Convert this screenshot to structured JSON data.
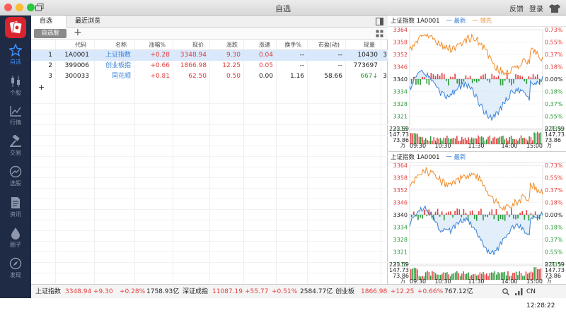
{
  "window": {
    "title": "自选",
    "feedback": "反馈",
    "login": "登录"
  },
  "sidebar": {
    "items": [
      {
        "label": "自选"
      },
      {
        "label": "个股"
      },
      {
        "label": "行情"
      },
      {
        "label": "交易"
      },
      {
        "label": "选股"
      },
      {
        "label": "资讯"
      },
      {
        "label": "圈子"
      },
      {
        "label": "发现"
      }
    ]
  },
  "tabs": [
    {
      "label": "自选"
    },
    {
      "label": "最近浏览"
    }
  ],
  "group": {
    "label": "自选股",
    "add": "+"
  },
  "table": {
    "columns": [
      "代码",
      "名称",
      "涨幅%",
      "现价",
      "涨跌",
      "涨速",
      "换手%",
      "市盈(动)",
      "现量"
    ],
    "rows": [
      {
        "idx": "1",
        "code": "1A0001",
        "name": "上证指数",
        "pct": "+0.28",
        "price": "3348.94",
        "chg": "9.30",
        "speed": "0.04",
        "turnover": "--",
        "pe": "--",
        "vol": "10430",
        "extra": "3"
      },
      {
        "idx": "2",
        "code": "399006",
        "name": "创业板指",
        "pct": "+0.66",
        "price": "1866.98",
        "chg": "12.25",
        "speed": "0.05",
        "turnover": "--",
        "pe": "--",
        "vol": "773697",
        "extra": ""
      },
      {
        "idx": "3",
        "code": "300033",
        "name": "同花顺",
        "pct": "+0.81",
        "price": "62.50",
        "chg": "0.50",
        "speed": "0.00",
        "turnover": "1.16",
        "pe": "58.66",
        "vol": "667↓",
        "extra": "3"
      }
    ],
    "add_row": "+"
  },
  "charts": [
    {
      "title": "上证指数 1A0001",
      "legend": [
        "一 最新",
        "一 领先"
      ],
      "price_left": [
        "3364",
        "3358",
        "3352",
        "3346",
        "3340",
        "3334",
        "3328",
        "3321",
        "3315"
      ],
      "pct_right": [
        "0.73%",
        "0.55%",
        "0.37%",
        "0.18%",
        "0.00%",
        "0.18%",
        "0.37%",
        "0.55%",
        "0.73%"
      ],
      "vol_labels": [
        "221.59",
        "147.73",
        "73.86"
      ],
      "vol_unit": "万",
      "times": [
        "09:30",
        "10:30",
        "11:30",
        "14:00",
        "15:00"
      ]
    },
    {
      "title": "上证指数 1A0001",
      "legend": [
        "一 最新"
      ],
      "price_left": [
        "3364",
        "3358",
        "3352",
        "3346",
        "3340",
        "3334",
        "3328",
        "3321",
        "3315"
      ],
      "pct_right": [
        "0.73%",
        "0.55%",
        "0.37%",
        "0.18%",
        "0.00%",
        "0.18%",
        "0.37%",
        "0.55%",
        "0.73%"
      ],
      "vol_labels": [
        "221.59",
        "147.73",
        "73.86"
      ],
      "vol_unit": "万",
      "times": [
        "09:30",
        "10:30",
        "11:30",
        "14:00",
        "15:00"
      ]
    }
  ],
  "status": {
    "sh_name": "上证指数",
    "sh_price": "3348.94",
    "sh_chg": "+9.30",
    "sh_pct": "+0.28%",
    "sh_amt": "1758.93亿",
    "sz_name": "深证成指",
    "sz_price": "11087.19",
    "sz_chg": "+55.77",
    "sz_pct": "+0.51%",
    "sz_amt": "2584.77亿",
    "cy_name": "创业板",
    "cy_price": "1866.98",
    "cy_chg": "+12.25",
    "cy_pct": "+0.66%",
    "cy_amt": "767.12亿",
    "clock": "CN 12:28:22"
  },
  "colors": {
    "accent": "#3d8bf2",
    "up": "#e43c3c",
    "down": "#2a9b3a",
    "latest": "#3b82d8",
    "lead": "#f08c2a"
  }
}
